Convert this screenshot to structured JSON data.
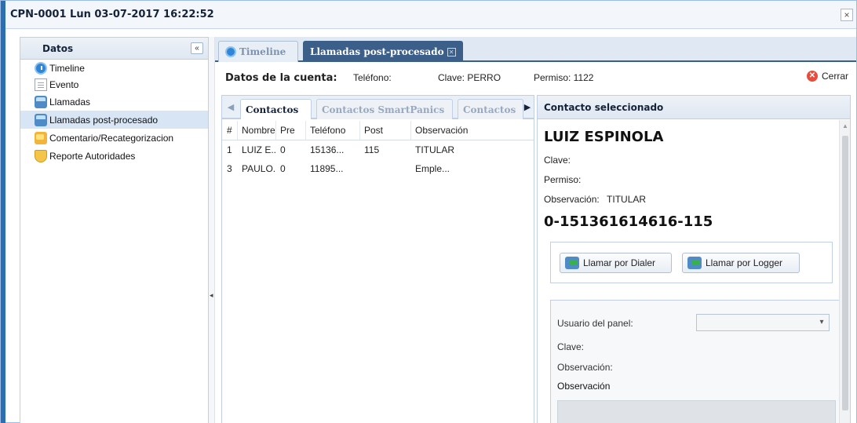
{
  "window": {
    "title": "CPN-0001 Lun 03-07-2017 16:22:52",
    "close_glyph": "×"
  },
  "sidebar": {
    "title": "Datos",
    "collapse_glyph": "«",
    "items": [
      {
        "label": "Timeline",
        "icon": "clock-icon"
      },
      {
        "label": "Evento",
        "icon": "document-icon"
      },
      {
        "label": "Llamadas",
        "icon": "phone-icon"
      },
      {
        "label": "Llamadas post-procesado",
        "icon": "phone-icon",
        "selected": true
      },
      {
        "label": "Comentario/Recategorizacion",
        "icon": "comment-icon"
      },
      {
        "label": "Reporte Autoridades",
        "icon": "shield-icon"
      }
    ]
  },
  "tabs": [
    {
      "label": "Timeline",
      "active": false
    },
    {
      "label": "Llamadas post-procesado",
      "active": true
    }
  ],
  "account": {
    "title": "Datos de la cuenta:",
    "telefono": "Teléfono:",
    "clave": "Clave: PERRO",
    "permiso": "Permiso: 1122",
    "close_label": "Cerrar"
  },
  "contacts_tabs": [
    "Contactos",
    "Contactos SmartPanics",
    "Contactos"
  ],
  "grid": {
    "columns": [
      "#",
      "Nombre",
      "Pre",
      "Teléfono",
      "Post",
      "Observación"
    ],
    "rows": [
      [
        "1",
        "LUIZ E...",
        "0",
        "15136...",
        "115",
        "TITULAR"
      ],
      [
        "3",
        "PAULO...",
        "0",
        "11895...",
        "",
        "Emple..."
      ]
    ]
  },
  "contact": {
    "panel_title": "Contacto seleccionado",
    "name": "LUIZ ESPINOLA",
    "clave_label": "Clave:",
    "permiso_label": "Permiso:",
    "observacion_label": "Observación:",
    "observacion_value": "TITULAR",
    "number": "0-151361614616-115",
    "dialer_button": "Llamar por Dialer",
    "logger_button": "Llamar por Logger",
    "panel_user_label": "Usuario del panel:",
    "panel_clave_label": "Clave:",
    "panel_obs_label": "Observación:",
    "obs_title": "Observación"
  }
}
